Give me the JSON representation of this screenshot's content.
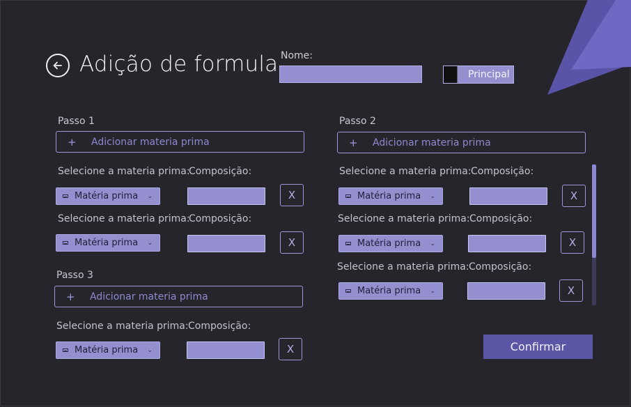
{
  "header": {
    "title": "Adição de formula",
    "nome_label": "Nome:",
    "nome_value": "",
    "toggle_label": "Principal"
  },
  "labels": {
    "add": "Adicionar materia prima",
    "select": "Selecione a materia prima:",
    "composition": "Composição:",
    "material": "Matéria prima",
    "remove": "X"
  },
  "steps": [
    {
      "title": "Passo 1"
    },
    {
      "title": "Passo 2"
    },
    {
      "title": "Passo 3"
    }
  ],
  "confirm_label": "Confirmar",
  "icons": {
    "back": "arrow-left-circle-icon",
    "add": "plus-icon",
    "select": "mail-icon",
    "dropdown": "chevron-down-icon"
  },
  "colors": {
    "background": "#26252b",
    "accent": "#9490d0",
    "confirm": "#5c56a6",
    "decor": "#5a54a8"
  }
}
